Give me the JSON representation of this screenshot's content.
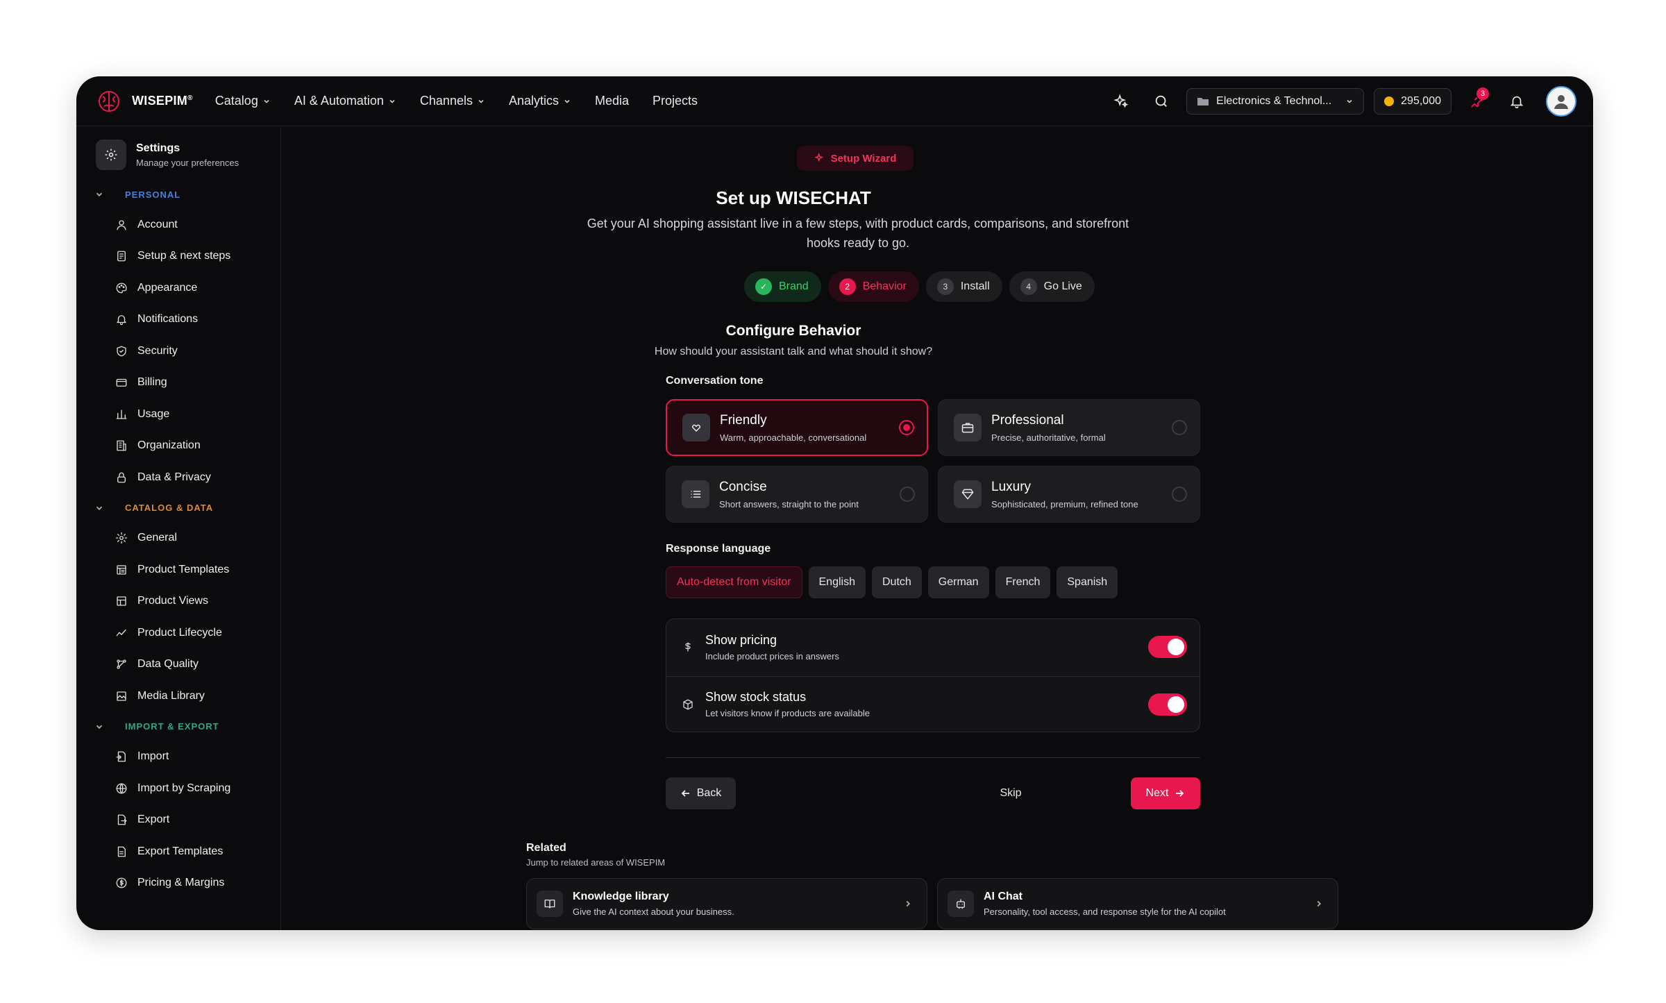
{
  "brand": {
    "name": "WISEPIM",
    "mark": "®"
  },
  "nav": {
    "items": [
      {
        "label": "Catalog",
        "dropdown": true
      },
      {
        "label": "AI & Automation",
        "dropdown": true
      },
      {
        "label": "Channels",
        "dropdown": true
      },
      {
        "label": "Analytics",
        "dropdown": true
      },
      {
        "label": "Media",
        "dropdown": false
      },
      {
        "label": "Projects",
        "dropdown": false
      }
    ]
  },
  "topbar": {
    "workspace": "Electronics & Technol...",
    "credits": "295,000",
    "notifications_count": "3",
    "icons": [
      "sparkles-icon",
      "search-icon",
      "folder-icon",
      "coin-icon",
      "pin-icon",
      "bell-icon",
      "avatar-icon"
    ]
  },
  "sidebar": {
    "title": "Settings",
    "subtitle": "Manage your preferences",
    "groups": [
      {
        "label": "PERSONAL",
        "color": "#4a7fd8",
        "items": [
          {
            "label": "Account",
            "icon": "user-icon"
          },
          {
            "label": "Setup & next steps",
            "icon": "checklist-icon"
          },
          {
            "label": "Appearance",
            "icon": "palette-icon"
          },
          {
            "label": "Notifications",
            "icon": "bell-icon"
          },
          {
            "label": "Security",
            "icon": "shield-icon"
          },
          {
            "label": "Billing",
            "icon": "credit-card-icon"
          },
          {
            "label": "Usage",
            "icon": "bar-chart-icon"
          },
          {
            "label": "Organization",
            "icon": "building-icon"
          },
          {
            "label": "Data & Privacy",
            "icon": "lock-icon"
          }
        ]
      },
      {
        "label": "CATALOG & DATA",
        "color": "#e08a2c",
        "items": [
          {
            "label": "General",
            "icon": "gear-icon"
          },
          {
            "label": "Product Templates",
            "icon": "template-icon"
          },
          {
            "label": "Product Views",
            "icon": "grid-icon"
          },
          {
            "label": "Product Lifecycle",
            "icon": "trend-icon"
          },
          {
            "label": "Data Quality",
            "icon": "flow-icon"
          },
          {
            "label": "Media Library",
            "icon": "image-icon"
          }
        ]
      },
      {
        "label": "IMPORT & EXPORT",
        "color": "#2fa88a",
        "items": [
          {
            "label": "Import",
            "icon": "file-import-icon"
          },
          {
            "label": "Import by Scraping",
            "icon": "globe-icon"
          },
          {
            "label": "Export",
            "icon": "file-export-icon"
          },
          {
            "label": "Export Templates",
            "icon": "file-template-icon"
          },
          {
            "label": "Pricing & Margins",
            "icon": "dollar-circle-icon"
          }
        ]
      }
    ]
  },
  "wizard": {
    "pill": "Setup Wizard",
    "title": "Set up WISECHAT",
    "subtitle": "Get your AI shopping assistant live in a few steps, with product cards, comparisons, and storefront hooks ready to go.",
    "steps": [
      {
        "num": "✓",
        "label": "Brand",
        "state": "done"
      },
      {
        "num": "2",
        "label": "Behavior",
        "state": "active"
      },
      {
        "num": "3",
        "label": "Install",
        "state": "pending"
      },
      {
        "num": "4",
        "label": "Go Live",
        "state": "pending"
      }
    ],
    "section_title": "Configure Behavior",
    "section_sub": "How should your assistant talk and what should it show?",
    "tone_label": "Conversation tone",
    "tones": [
      {
        "name": "Friendly",
        "desc": "Warm, approachable, conversational",
        "selected": true,
        "icon": "heart-hands-icon"
      },
      {
        "name": "Professional",
        "desc": "Precise, authoritative, formal",
        "selected": false,
        "icon": "briefcase-icon"
      },
      {
        "name": "Concise",
        "desc": "Short answers, straight to the point",
        "selected": false,
        "icon": "list-icon"
      },
      {
        "name": "Luxury",
        "desc": "Sophisticated, premium, refined tone",
        "selected": false,
        "icon": "diamond-icon"
      }
    ],
    "language_label": "Response language",
    "languages": [
      {
        "label": "Auto-detect from visitor",
        "selected": true
      },
      {
        "label": "English",
        "selected": false
      },
      {
        "label": "Dutch",
        "selected": false
      },
      {
        "label": "German",
        "selected": false
      },
      {
        "label": "French",
        "selected": false
      },
      {
        "label": "Spanish",
        "selected": false
      }
    ],
    "toggles": [
      {
        "title": "Show pricing",
        "sub": "Include product prices in answers",
        "on": true,
        "icon": "dollar-icon"
      },
      {
        "title": "Show stock status",
        "sub": "Let visitors know if products are available",
        "on": true,
        "icon": "package-icon"
      }
    ],
    "back_label": "Back",
    "skip_label": "Skip",
    "next_label": "Next"
  },
  "related": {
    "title": "Related",
    "subtitle": "Jump to related areas of WISEPIM",
    "cards": [
      {
        "name": "Knowledge library",
        "desc": "Give the AI context about your business.",
        "icon": "book-icon"
      },
      {
        "name": "AI Chat",
        "desc": "Personality, tool access, and response style for the AI copilot",
        "icon": "bot-icon"
      }
    ]
  },
  "colors": {
    "accent": "#e8174e",
    "success": "#2bb55a",
    "background": "#0b0b0d"
  }
}
